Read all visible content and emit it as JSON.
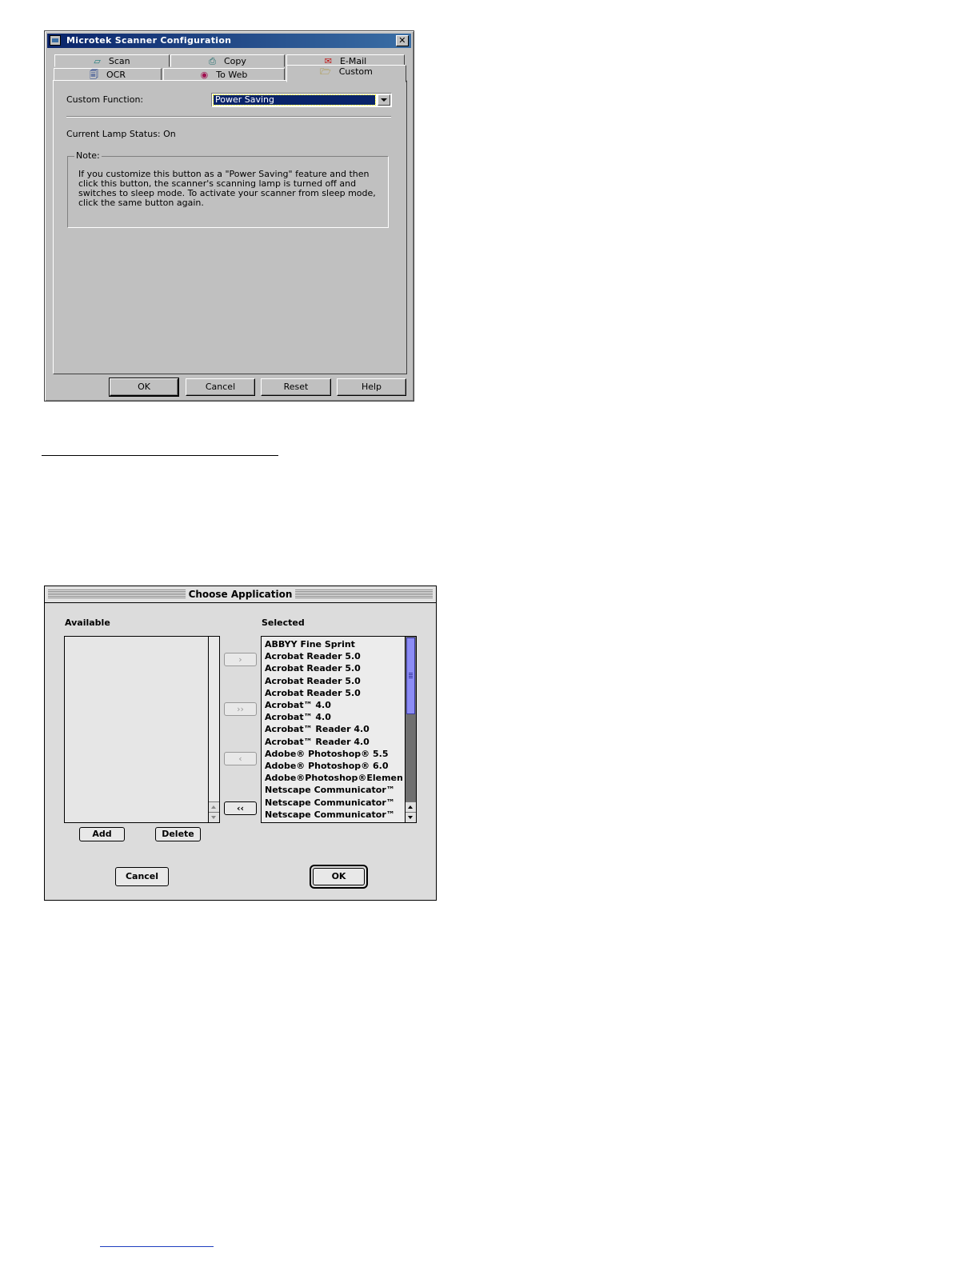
{
  "win_dialog": {
    "title": "Microtek Scanner Configuration",
    "close": "✕",
    "tabs_row1": [
      {
        "label": "Scan",
        "icon": "scanner-icon"
      },
      {
        "label": "Copy",
        "icon": "printer-icon"
      },
      {
        "label": "E-Mail",
        "icon": "mail-icon"
      }
    ],
    "tabs_row2": [
      {
        "label": "OCR",
        "icon": "ocr-icon"
      },
      {
        "label": "To Web",
        "icon": "globe-icon"
      },
      {
        "label": "Custom",
        "icon": "folder-icon"
      }
    ],
    "active_tab": "Custom",
    "custom_function_label": "Custom Function:",
    "custom_function_value": "Power Saving",
    "lamp_status": "Current Lamp Status: On",
    "note_title": "Note:",
    "note_text": "If you customize this button as a \"Power Saving\" feature and then click this button, the scanner's scanning lamp is turned off and switches to sleep mode. To activate your scanner from sleep mode, click the same button again.",
    "buttons": {
      "ok": "OK",
      "cancel": "Cancel",
      "reset": "Reset",
      "help": "Help"
    }
  },
  "mac_dialog": {
    "title": "Choose Application",
    "available_label": "Available",
    "selected_label": "Selected",
    "available_items": [],
    "selected_items": [
      "ABBYY Fine Sprint",
      "Acrobat Reader 5.0",
      "Acrobat Reader 5.0",
      "Acrobat Reader 5.0",
      "Acrobat Reader 5.0",
      "Acrobat™ 4.0",
      "Acrobat™ 4.0",
      "Acrobat™ Reader 4.0",
      "Acrobat™ Reader 4.0",
      "Adobe® Photoshop® 5.5",
      "Adobe® Photoshop® 6.0",
      "Adobe®Photoshop®Elements",
      "Netscape Communicator™",
      "Netscape Communicator™",
      "Netscape Communicator™"
    ],
    "move_buttons": {
      "add_one": "›",
      "add_all": "››",
      "remove_one": "‹",
      "remove_all": "‹‹"
    },
    "add": "Add",
    "delete": "Delete",
    "cancel": "Cancel",
    "ok": "OK"
  },
  "colors": {
    "win_title": "#0a246a",
    "win_face": "#c0c0c0",
    "mac_face": "#dcdcdc",
    "scroll_thumb": "#8c8cf5"
  }
}
